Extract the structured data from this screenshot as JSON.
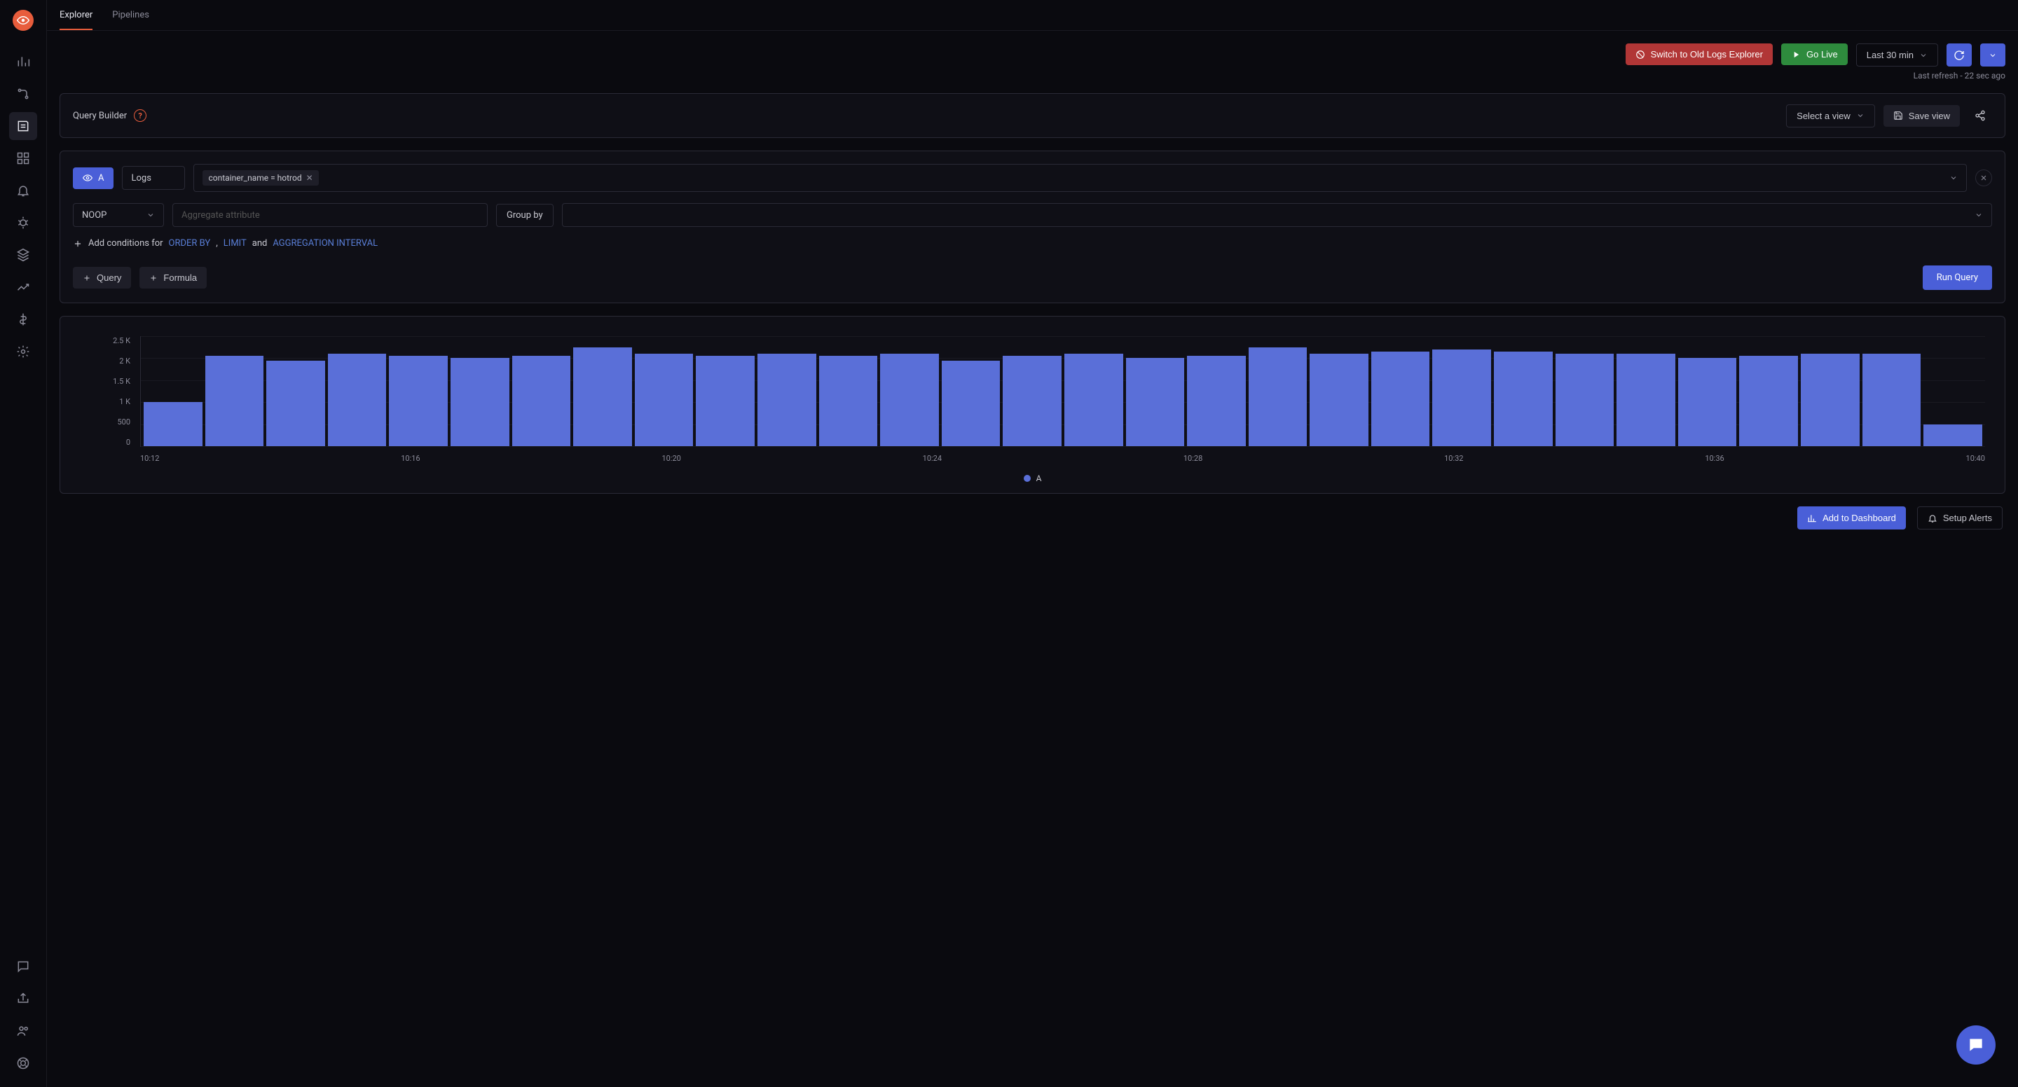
{
  "nav": {
    "items": [
      "metrics",
      "traces",
      "logs",
      "dashboards",
      "alerts",
      "debug",
      "services",
      "apm",
      "billing",
      "settings"
    ],
    "active_index": 2,
    "bottom_items": [
      "help",
      "share",
      "users",
      "support"
    ]
  },
  "tabs": {
    "items": [
      {
        "id": "explorer",
        "label": "Explorer",
        "active": true
      },
      {
        "id": "pipelines",
        "label": "Pipelines",
        "active": false
      }
    ]
  },
  "top_controls": {
    "switch_old_label": "Switch to Old Logs Explorer",
    "go_live_label": "Go Live",
    "time_range": "Last 30 min",
    "last_refresh": "Last refresh - 22 sec ago"
  },
  "query_builder": {
    "title": "Query Builder",
    "select_view_label": "Select a view",
    "save_view_label": "Save view"
  },
  "query": {
    "badge": "A",
    "source": "Logs",
    "filter_chip": "container_name = hotrod",
    "noop": "NOOP",
    "agg_placeholder": "Aggregate attribute",
    "group_by_label": "Group by",
    "conditions_prefix": "Add conditions for",
    "cond_order": "ORDER BY",
    "cond_sep": ",",
    "cond_limit": "LIMIT",
    "cond_and": "and",
    "cond_agg": "AGGREGATION INTERVAL",
    "query_btn": "Query",
    "formula_btn": "Formula",
    "run_btn": "Run Query"
  },
  "chart_data": {
    "type": "bar",
    "title": "",
    "xlabel": "",
    "ylabel": "",
    "y_ticks": [
      "2.5 K",
      "2 K",
      "1.5 K",
      "1 K",
      "500",
      "0"
    ],
    "ylim": [
      0,
      2500
    ],
    "categories": [
      "10:12",
      "10:16",
      "10:20",
      "10:24",
      "10:28",
      "10:32",
      "10:36",
      "10:40"
    ],
    "x_tick_count": 8,
    "series": [
      {
        "name": "A",
        "values": [
          1000,
          2050,
          1950,
          2100,
          2050,
          2000,
          2050,
          2250,
          2100,
          2050,
          2100,
          2050,
          2100,
          1950,
          2050,
          2100,
          2000,
          2050,
          2250,
          2100,
          2150,
          2200,
          2150,
          2100,
          2100,
          2000,
          2050,
          2100,
          2100,
          500
        ]
      }
    ],
    "legend_label": "A"
  },
  "bottom": {
    "add_dashboard": "Add to Dashboard",
    "setup_alerts": "Setup Alerts"
  },
  "colors": {
    "accent": "#4a5fd8",
    "brand": "#e85d3c",
    "danger": "#b13636",
    "success": "#2e8b3d"
  }
}
